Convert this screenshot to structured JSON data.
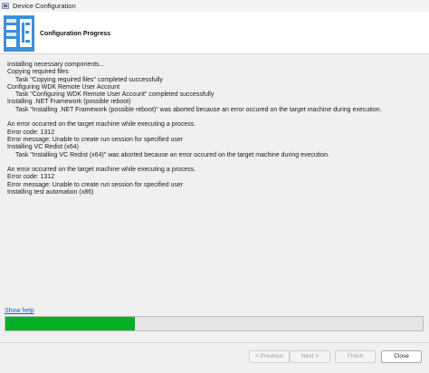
{
  "window": {
    "title": "Device Configuration"
  },
  "header": {
    "title": "Configuration Progress"
  },
  "log": [
    {
      "text": "Installing necessary components...",
      "indent": false
    },
    {
      "text": "Copying required files",
      "indent": false
    },
    {
      "text": "Task \"Copying required files\" completed successfully",
      "indent": true
    },
    {
      "text": "Configuring WDK Remote User Account",
      "indent": false
    },
    {
      "text": "Task \"Configuring WDK Remote User Account\" completed successfully",
      "indent": true
    },
    {
      "text": "Installing .NET Framework (possible reboot)",
      "indent": false
    },
    {
      "text": "Task \"Installing .NET Framework (possible reboot)\" was aborted because an error occured on the target machine during execution.",
      "indent": true
    },
    {
      "text": "",
      "indent": false
    },
    {
      "text": "An error occurred on the target machine while executing a process.",
      "indent": false
    },
    {
      "text": "Error code: 1312",
      "indent": false
    },
    {
      "text": "Error message: Unable to create run session for specified user",
      "indent": false
    },
    {
      "text": "Installing VC Redist (x64)",
      "indent": false
    },
    {
      "text": "Task \"Installing VC Redist (x64)\" was aborted because an error occured on the target machine during execution.",
      "indent": true
    },
    {
      "text": "",
      "indent": false
    },
    {
      "text": "An error occurred on the target machine while executing a process.",
      "indent": false
    },
    {
      "text": "Error code: 1312",
      "indent": false
    },
    {
      "text": "Error message: Unable to create run session for specified user",
      "indent": false
    },
    {
      "text": "Installing test automation (x86)",
      "indent": false
    }
  ],
  "help_link": "Show help",
  "progress": {
    "fraction": 0.31,
    "color": "#06b025"
  },
  "buttons": {
    "previous": "< Previous",
    "next": "Next >",
    "finish": "Finish",
    "close": "Close"
  }
}
